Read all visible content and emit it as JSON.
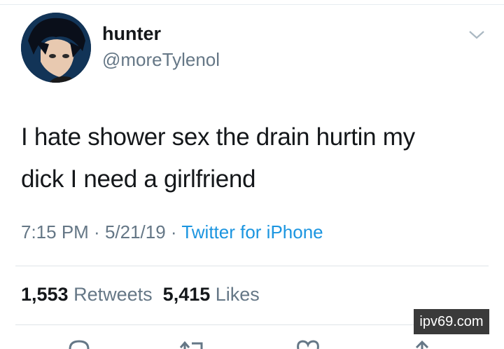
{
  "user": {
    "display_name": "hunter",
    "handle": "@moreTylenol"
  },
  "tweet": {
    "text_line1": "I hate shower sex the drain hurtin my",
    "text_line2": "dick I need a girlfriend"
  },
  "meta": {
    "time": "7:15 PM",
    "sep1": " · ",
    "date": "5/21/19",
    "sep2": " · ",
    "source": "Twitter for iPhone"
  },
  "stats": {
    "retweets_count": "1,553",
    "retweets_label": "Retweets",
    "likes_count": "5,415",
    "likes_label": "Likes"
  },
  "watermark": {
    "text": "ipv69.com"
  },
  "icons": {
    "menu": "chevron-down-icon",
    "reply": "reply-icon",
    "retweet": "retweet-icon",
    "like": "heart-icon",
    "share": "share-icon"
  },
  "colors": {
    "text": "#14171a",
    "secondary": "#657786",
    "link": "#1b95e0"
  }
}
